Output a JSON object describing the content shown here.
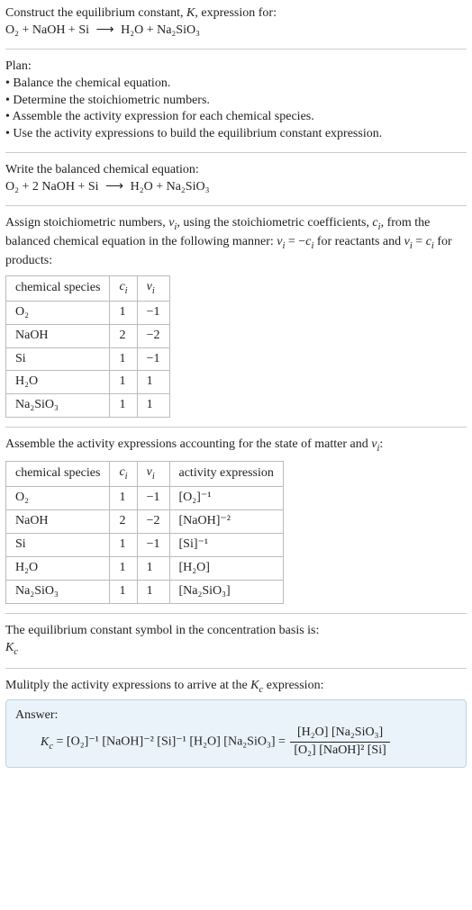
{
  "intro": {
    "line1": "Construct the equilibrium constant, K, expression for:",
    "equation_lhs": "O₂ + NaOH + Si",
    "arrow": "⟶",
    "equation_rhs": "H₂O + Na₂SiO₃"
  },
  "plan": {
    "title": "Plan:",
    "b1": "• Balance the chemical equation.",
    "b2": "• Determine the stoichiometric numbers.",
    "b3": "• Assemble the activity expression for each chemical species.",
    "b4": "• Use the activity expressions to build the equilibrium constant expression."
  },
  "balanced": {
    "title": "Write the balanced chemical equation:",
    "lhs": "O₂ + 2 NaOH + Si",
    "arrow": "⟶",
    "rhs": "H₂O + Na₂SiO₃"
  },
  "stoich": {
    "intro_a": "Assign stoichiometric numbers, νᵢ, using the stoichiometric coefficients, cᵢ, from the balanced chemical equation in the following manner: νᵢ = −cᵢ for reactants and νᵢ = cᵢ for products:",
    "headers": {
      "h1": "chemical species",
      "h2": "cᵢ",
      "h3": "νᵢ"
    },
    "rows": [
      {
        "s": "O₂",
        "c": "1",
        "v": "−1"
      },
      {
        "s": "NaOH",
        "c": "2",
        "v": "−2"
      },
      {
        "s": "Si",
        "c": "1",
        "v": "−1"
      },
      {
        "s": "H₂O",
        "c": "1",
        "v": "1"
      },
      {
        "s": "Na₂SiO₃",
        "c": "1",
        "v": "1"
      }
    ]
  },
  "activity": {
    "intro": "Assemble the activity expressions accounting for the state of matter and νᵢ:",
    "headers": {
      "h1": "chemical species",
      "h2": "cᵢ",
      "h3": "νᵢ",
      "h4": "activity expression"
    },
    "rows": [
      {
        "s": "O₂",
        "c": "1",
        "v": "−1",
        "a": "[O₂]⁻¹"
      },
      {
        "s": "NaOH",
        "c": "2",
        "v": "−2",
        "a": "[NaOH]⁻²"
      },
      {
        "s": "Si",
        "c": "1",
        "v": "−1",
        "a": "[Si]⁻¹"
      },
      {
        "s": "H₂O",
        "c": "1",
        "v": "1",
        "a": "[H₂O]"
      },
      {
        "s": "Na₂SiO₃",
        "c": "1",
        "v": "1",
        "a": "[Na₂SiO₃]"
      }
    ]
  },
  "symbol": {
    "line": "The equilibrium constant symbol in the concentration basis is:",
    "sym": "K_c"
  },
  "multiply": {
    "line": "Mulitply the activity expressions to arrive at the K_c expression:"
  },
  "answer": {
    "label": "Answer:",
    "kc": "K_c =",
    "flat": "[O₂]⁻¹ [NaOH]⁻² [Si]⁻¹ [H₂O] [Na₂SiO₃] =",
    "num": "[H₂O] [Na₂SiO₃]",
    "den": "[O₂] [NaOH]² [Si]"
  },
  "chart_data": {
    "type": "table",
    "tables": [
      {
        "title": "stoichiometric numbers",
        "columns": [
          "chemical species",
          "c_i",
          "ν_i"
        ],
        "rows": [
          [
            "O2",
            1,
            -1
          ],
          [
            "NaOH",
            2,
            -2
          ],
          [
            "Si",
            1,
            -1
          ],
          [
            "H2O",
            1,
            1
          ],
          [
            "Na2SiO3",
            1,
            1
          ]
        ]
      },
      {
        "title": "activity expressions",
        "columns": [
          "chemical species",
          "c_i",
          "ν_i",
          "activity expression"
        ],
        "rows": [
          [
            "O2",
            1,
            -1,
            "[O2]^-1"
          ],
          [
            "NaOH",
            2,
            -2,
            "[NaOH]^-2"
          ],
          [
            "Si",
            1,
            -1,
            "[Si]^-1"
          ],
          [
            "H2O",
            1,
            1,
            "[H2O]"
          ],
          [
            "Na2SiO3",
            1,
            1,
            "[Na2SiO3]"
          ]
        ]
      }
    ]
  }
}
